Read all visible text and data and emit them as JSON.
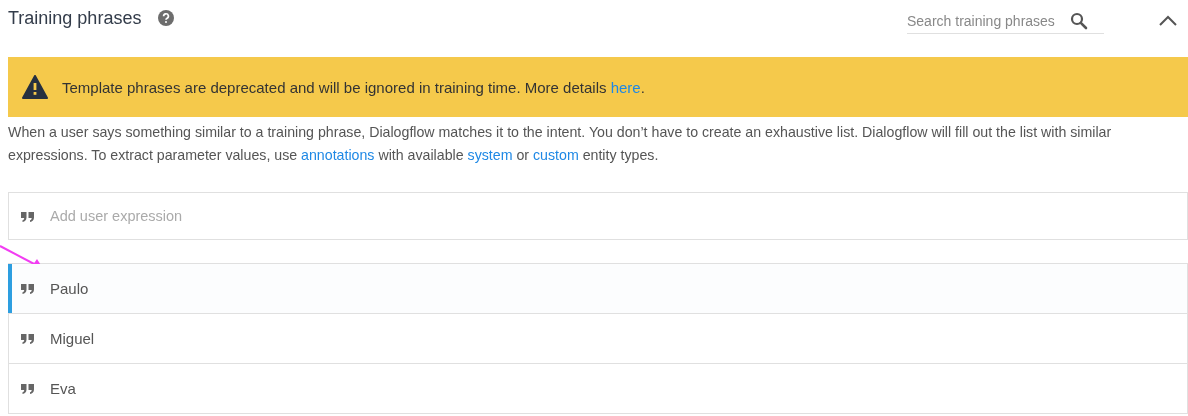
{
  "section": {
    "title": "Training phrases",
    "collapsed": false
  },
  "search": {
    "placeholder": "Search training phrases"
  },
  "banner": [
    {
      "kind": "text",
      "text": "Template phrases are deprecated and will be ignored in training time. More details "
    },
    {
      "kind": "link",
      "text": "here"
    },
    {
      "kind": "text",
      "text": "."
    }
  ],
  "description": [
    {
      "kind": "text",
      "text": "When a user says something similar to a training phrase, Dialogflow matches it to the intent. You don’t have to create an exhaustive list. Dialogflow will fill out the list with similar expressions. To extract parameter values, use "
    },
    {
      "kind": "link",
      "text": "annotations"
    },
    {
      "kind": "text",
      "text": " with available "
    },
    {
      "kind": "link",
      "text": "system"
    },
    {
      "kind": "text",
      "text": " or "
    },
    {
      "kind": "link",
      "text": "custom"
    },
    {
      "kind": "text",
      "text": " entity types."
    }
  ],
  "new_phrase": {
    "placeholder": "Add user expression"
  },
  "phrases": [
    {
      "text": "Paulo",
      "selected": true
    },
    {
      "text": "Miguel",
      "selected": false
    },
    {
      "text": "Eva",
      "selected": false
    }
  ],
  "annotation": {
    "kind": "arrow"
  }
}
